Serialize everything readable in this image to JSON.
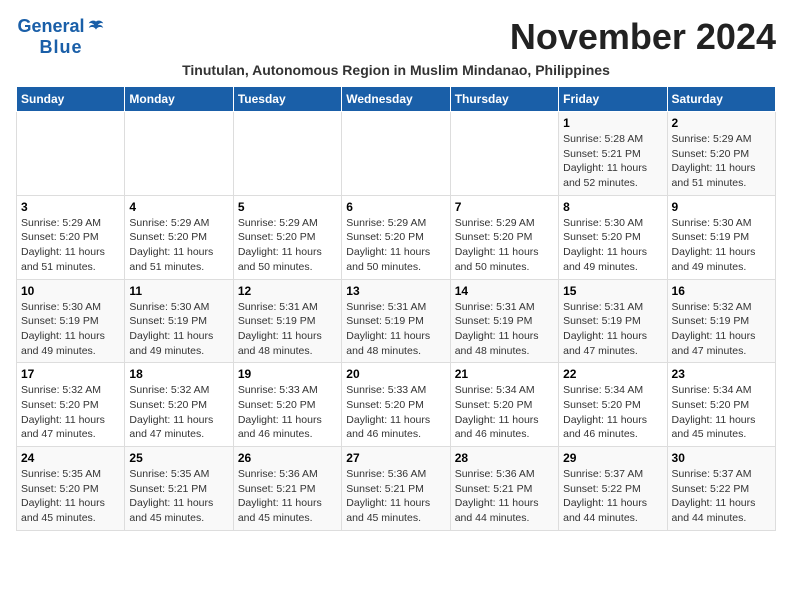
{
  "header": {
    "logo_general": "General",
    "logo_blue": "Blue",
    "month_title": "November 2024",
    "subtitle": "Tinutulan, Autonomous Region in Muslim Mindanao, Philippines"
  },
  "weekdays": [
    "Sunday",
    "Monday",
    "Tuesday",
    "Wednesday",
    "Thursday",
    "Friday",
    "Saturday"
  ],
  "weeks": [
    [
      {
        "day": "",
        "info": ""
      },
      {
        "day": "",
        "info": ""
      },
      {
        "day": "",
        "info": ""
      },
      {
        "day": "",
        "info": ""
      },
      {
        "day": "",
        "info": ""
      },
      {
        "day": "1",
        "info": "Sunrise: 5:28 AM\nSunset: 5:21 PM\nDaylight: 11 hours and 52 minutes."
      },
      {
        "day": "2",
        "info": "Sunrise: 5:29 AM\nSunset: 5:20 PM\nDaylight: 11 hours and 51 minutes."
      }
    ],
    [
      {
        "day": "3",
        "info": "Sunrise: 5:29 AM\nSunset: 5:20 PM\nDaylight: 11 hours and 51 minutes."
      },
      {
        "day": "4",
        "info": "Sunrise: 5:29 AM\nSunset: 5:20 PM\nDaylight: 11 hours and 51 minutes."
      },
      {
        "day": "5",
        "info": "Sunrise: 5:29 AM\nSunset: 5:20 PM\nDaylight: 11 hours and 50 minutes."
      },
      {
        "day": "6",
        "info": "Sunrise: 5:29 AM\nSunset: 5:20 PM\nDaylight: 11 hours and 50 minutes."
      },
      {
        "day": "7",
        "info": "Sunrise: 5:29 AM\nSunset: 5:20 PM\nDaylight: 11 hours and 50 minutes."
      },
      {
        "day": "8",
        "info": "Sunrise: 5:30 AM\nSunset: 5:20 PM\nDaylight: 11 hours and 49 minutes."
      },
      {
        "day": "9",
        "info": "Sunrise: 5:30 AM\nSunset: 5:19 PM\nDaylight: 11 hours and 49 minutes."
      }
    ],
    [
      {
        "day": "10",
        "info": "Sunrise: 5:30 AM\nSunset: 5:19 PM\nDaylight: 11 hours and 49 minutes."
      },
      {
        "day": "11",
        "info": "Sunrise: 5:30 AM\nSunset: 5:19 PM\nDaylight: 11 hours and 49 minutes."
      },
      {
        "day": "12",
        "info": "Sunrise: 5:31 AM\nSunset: 5:19 PM\nDaylight: 11 hours and 48 minutes."
      },
      {
        "day": "13",
        "info": "Sunrise: 5:31 AM\nSunset: 5:19 PM\nDaylight: 11 hours and 48 minutes."
      },
      {
        "day": "14",
        "info": "Sunrise: 5:31 AM\nSunset: 5:19 PM\nDaylight: 11 hours and 48 minutes."
      },
      {
        "day": "15",
        "info": "Sunrise: 5:31 AM\nSunset: 5:19 PM\nDaylight: 11 hours and 47 minutes."
      },
      {
        "day": "16",
        "info": "Sunrise: 5:32 AM\nSunset: 5:19 PM\nDaylight: 11 hours and 47 minutes."
      }
    ],
    [
      {
        "day": "17",
        "info": "Sunrise: 5:32 AM\nSunset: 5:20 PM\nDaylight: 11 hours and 47 minutes."
      },
      {
        "day": "18",
        "info": "Sunrise: 5:32 AM\nSunset: 5:20 PM\nDaylight: 11 hours and 47 minutes."
      },
      {
        "day": "19",
        "info": "Sunrise: 5:33 AM\nSunset: 5:20 PM\nDaylight: 11 hours and 46 minutes."
      },
      {
        "day": "20",
        "info": "Sunrise: 5:33 AM\nSunset: 5:20 PM\nDaylight: 11 hours and 46 minutes."
      },
      {
        "day": "21",
        "info": "Sunrise: 5:34 AM\nSunset: 5:20 PM\nDaylight: 11 hours and 46 minutes."
      },
      {
        "day": "22",
        "info": "Sunrise: 5:34 AM\nSunset: 5:20 PM\nDaylight: 11 hours and 46 minutes."
      },
      {
        "day": "23",
        "info": "Sunrise: 5:34 AM\nSunset: 5:20 PM\nDaylight: 11 hours and 45 minutes."
      }
    ],
    [
      {
        "day": "24",
        "info": "Sunrise: 5:35 AM\nSunset: 5:20 PM\nDaylight: 11 hours and 45 minutes."
      },
      {
        "day": "25",
        "info": "Sunrise: 5:35 AM\nSunset: 5:21 PM\nDaylight: 11 hours and 45 minutes."
      },
      {
        "day": "26",
        "info": "Sunrise: 5:36 AM\nSunset: 5:21 PM\nDaylight: 11 hours and 45 minutes."
      },
      {
        "day": "27",
        "info": "Sunrise: 5:36 AM\nSunset: 5:21 PM\nDaylight: 11 hours and 45 minutes."
      },
      {
        "day": "28",
        "info": "Sunrise: 5:36 AM\nSunset: 5:21 PM\nDaylight: 11 hours and 44 minutes."
      },
      {
        "day": "29",
        "info": "Sunrise: 5:37 AM\nSunset: 5:22 PM\nDaylight: 11 hours and 44 minutes."
      },
      {
        "day": "30",
        "info": "Sunrise: 5:37 AM\nSunset: 5:22 PM\nDaylight: 11 hours and 44 minutes."
      }
    ]
  ]
}
